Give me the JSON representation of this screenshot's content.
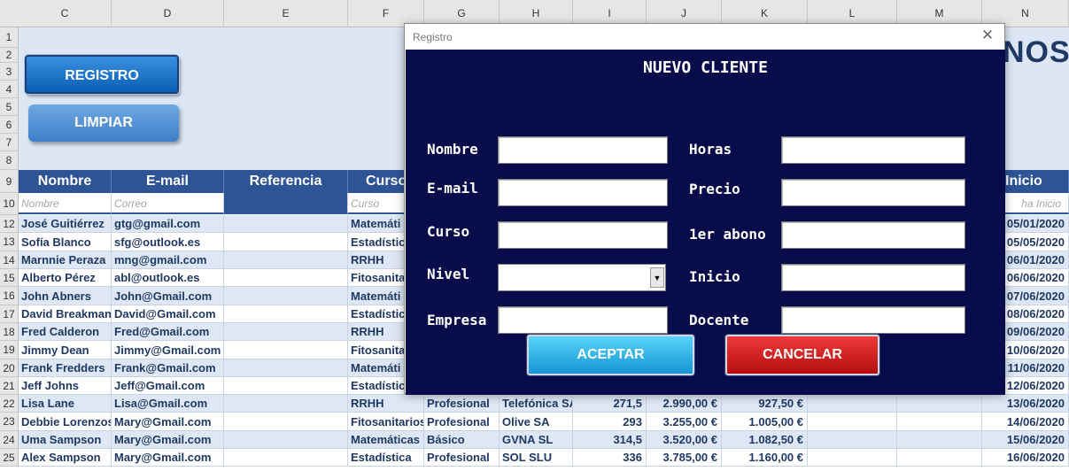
{
  "sheet": {
    "columns": [
      "C",
      "D",
      "E",
      "F",
      "G",
      "H",
      "I",
      "J",
      "K",
      "L",
      "M",
      "N"
    ],
    "rows": [
      "1",
      "2",
      "3",
      "4",
      "5",
      "6",
      "7",
      "8",
      "9",
      "10",
      "12",
      "13",
      "14",
      "15",
      "16",
      "17",
      "18",
      "19",
      "20",
      "21",
      "22",
      "23",
      "24",
      "25"
    ],
    "buttons": {
      "registro": "REGISTRO",
      "limpiar": "LIMPIAR"
    },
    "banner_title_fragment": "NOS",
    "headers": {
      "nombre": "Nombre",
      "email": "E-mail",
      "referencia": "Referencia",
      "curso": "Curso",
      "inicio": "Inicio"
    },
    "placeholders": {
      "nombre": "Nombre",
      "email": "Correo",
      "curso": "Curso",
      "inicio": "ha Inicio"
    },
    "data_rows": [
      {
        "nombre": "José Guitiérrez",
        "email": "gtg@gmail.com",
        "curso": "Matemáti",
        "nivel": "",
        "empresa": "",
        "horas": "",
        "precio": "",
        "abono": "",
        "inicio": "05/01/2020"
      },
      {
        "nombre": "Sofía Blanco",
        "email": "sfg@outlook.es",
        "curso": "Estadística",
        "nivel": "",
        "empresa": "",
        "horas": "",
        "precio": "",
        "abono": "",
        "inicio": "05/05/2020"
      },
      {
        "nombre": "Marnnie Peraza",
        "email": "mng@gmail.com",
        "curso": "RRHH",
        "nivel": "",
        "empresa": "",
        "horas": "",
        "precio": "",
        "abono": "",
        "inicio": "06/01/2020"
      },
      {
        "nombre": "Alberto Pérez",
        "email": "abl@outlook.es",
        "curso": "Fitosanita",
        "nivel": "",
        "empresa": "",
        "horas": "",
        "precio": "",
        "abono": "",
        "inicio": "06/06/2020"
      },
      {
        "nombre": "John Abners",
        "email": "John@Gmail.com",
        "curso": "Matemáti",
        "nivel": "",
        "empresa": "",
        "horas": "",
        "precio": "",
        "abono": "",
        "inicio": "07/06/2020"
      },
      {
        "nombre": "David Breakman",
        "email": "David@Gmail.com",
        "curso": "Estadística",
        "nivel": "",
        "empresa": "",
        "horas": "",
        "precio": "",
        "abono": "",
        "inicio": "08/06/2020"
      },
      {
        "nombre": "Fred Calderon",
        "email": "Fred@Gmail.com",
        "curso": "RRHH",
        "nivel": "",
        "empresa": "",
        "horas": "",
        "precio": "",
        "abono": "",
        "inicio": "09/06/2020"
      },
      {
        "nombre": "Jimmy Dean",
        "email": "Jimmy@Gmail.com",
        "curso": "Fitosanita",
        "nivel": "",
        "empresa": "",
        "horas": "",
        "precio": "",
        "abono": "",
        "inicio": "10/06/2020"
      },
      {
        "nombre": "Frank Fredders",
        "email": "Frank@Gmail.com",
        "curso": "Matemáti",
        "nivel": "",
        "empresa": "",
        "horas": "",
        "precio": "",
        "abono": "",
        "inicio": "11/06/2020"
      },
      {
        "nombre": "Jeff Johns",
        "email": "Jeff@Gmail.com",
        "curso": "Estadística",
        "nivel": "",
        "empresa": "",
        "horas": "",
        "precio": "",
        "abono": "",
        "inicio": "12/06/2020"
      },
      {
        "nombre": "Lisa Lane",
        "email": "Lisa@Gmail.com",
        "curso": "RRHH",
        "nivel": "Profesional",
        "empresa": "Telefónica SA",
        "horas": "271,5",
        "precio": "2.990,00 €",
        "abono": "927,50 €",
        "inicio": "13/06/2020"
      },
      {
        "nombre": "Debbie Lorenzos",
        "email": "Mary@Gmail.com",
        "curso": "Fitosanitarios",
        "nivel": "Profesional",
        "empresa": "Olive SA",
        "horas": "293",
        "precio": "3.255,00 €",
        "abono": "1.005,00 €",
        "inicio": "14/06/2020"
      },
      {
        "nombre": "Uma Sampson",
        "email": "Mary@Gmail.com",
        "curso": "Matemáticas",
        "nivel": "Básico",
        "empresa": "GVNA SL",
        "horas": "314,5",
        "precio": "3.520,00 €",
        "abono": "1.082,50 €",
        "inicio": "15/06/2020"
      },
      {
        "nombre": "Alex Sampson",
        "email": "Mary@Gmail.com",
        "curso": "Estadística",
        "nivel": "Profesional",
        "empresa": "SOL SLU",
        "horas": "336",
        "precio": "3.785,00 €",
        "abono": "1.160,00 €",
        "inicio": "16/06/2020"
      }
    ]
  },
  "dialog": {
    "title": "Registro",
    "heading": "NUEVO CLIENTE",
    "fields": {
      "nombre": "Nombre",
      "email": "E-mail",
      "curso": "Curso",
      "nivel": "Nivel",
      "empresa": "Empresa",
      "horas": "Horas",
      "precio": "Precio",
      "abono": "1er abono",
      "inicio": "Inicio",
      "docente": "Docente"
    },
    "values": {
      "nombre": "",
      "email": "",
      "curso": "",
      "nivel": "",
      "empresa": "",
      "horas": "",
      "precio": "",
      "abono": "",
      "inicio": "",
      "docente": ""
    },
    "buttons": {
      "aceptar": "ACEPTAR",
      "cancelar": "CANCELAR"
    }
  },
  "colors": {
    "header_blue": "#2f5496",
    "dialog_bg": "#080c4a",
    "banner_bg": "#dce6f4",
    "accept": "#1596d6",
    "cancel": "#b50d0d"
  }
}
